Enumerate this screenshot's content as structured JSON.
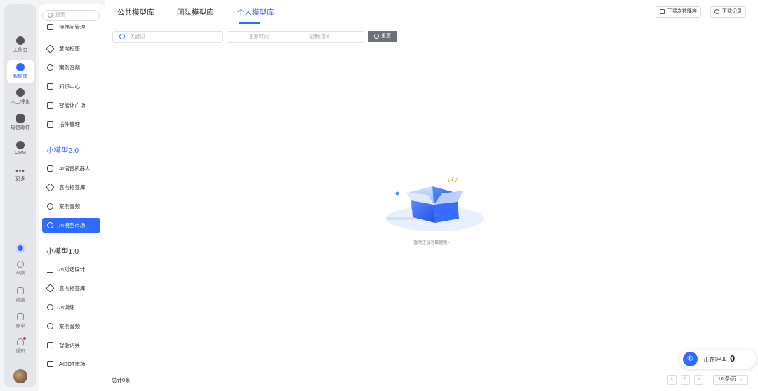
{
  "rail": {
    "items": [
      {
        "label": "工作台"
      },
      {
        "label": "智能体"
      },
      {
        "label": "人工呼出"
      },
      {
        "label": "短信邮件"
      },
      {
        "label": "CRM"
      },
      {
        "label": "更多"
      }
    ],
    "lower": [
      {
        "label": "坐席"
      },
      {
        "label": "线路"
      },
      {
        "label": "账单"
      },
      {
        "label": "通知"
      }
    ]
  },
  "sidebar": {
    "search_placeholder": "搜索",
    "top_partial": "操作间管理",
    "group1": [
      {
        "label": "意向标签"
      },
      {
        "label": "案例音频"
      },
      {
        "label": "知识中心"
      },
      {
        "label": "智能体广场"
      },
      {
        "label": "插件管理"
      }
    ],
    "section2": "小模型2.0",
    "group2": [
      {
        "label": "AI语音机器人"
      },
      {
        "label": "意向标签库"
      },
      {
        "label": "案例音频"
      },
      {
        "label": "AI模型市场"
      }
    ],
    "section3": "小模型1.0",
    "group3": [
      {
        "label": "AI对话设计"
      },
      {
        "label": "意向标签库"
      },
      {
        "label": "AI训练"
      },
      {
        "label": "案例音频"
      },
      {
        "label": "智能词典"
      },
      {
        "label": "AIBOT市场"
      }
    ]
  },
  "main": {
    "tabs": [
      {
        "label": "公共模型库"
      },
      {
        "label": "团队模型库"
      },
      {
        "label": "个人模型库"
      }
    ],
    "active_tab": 2,
    "download_sort": "下载次数降序",
    "download_record": "下载记录",
    "keyword_placeholder": "关键词",
    "date_start": "更新时间",
    "date_sep": "~",
    "date_end": "更新时间",
    "reset_label": "重置",
    "empty_text": "暂时还没有数据哦~",
    "total": "总计0条",
    "pager_prev": "<",
    "pager_page": "0",
    "pager_next": ">",
    "page_size": "10 条/页",
    "calling_label": "正在呼叫",
    "calling_count": "0"
  },
  "colors": {
    "accent": "#2f6bff",
    "reset_button": "#6e7079"
  }
}
